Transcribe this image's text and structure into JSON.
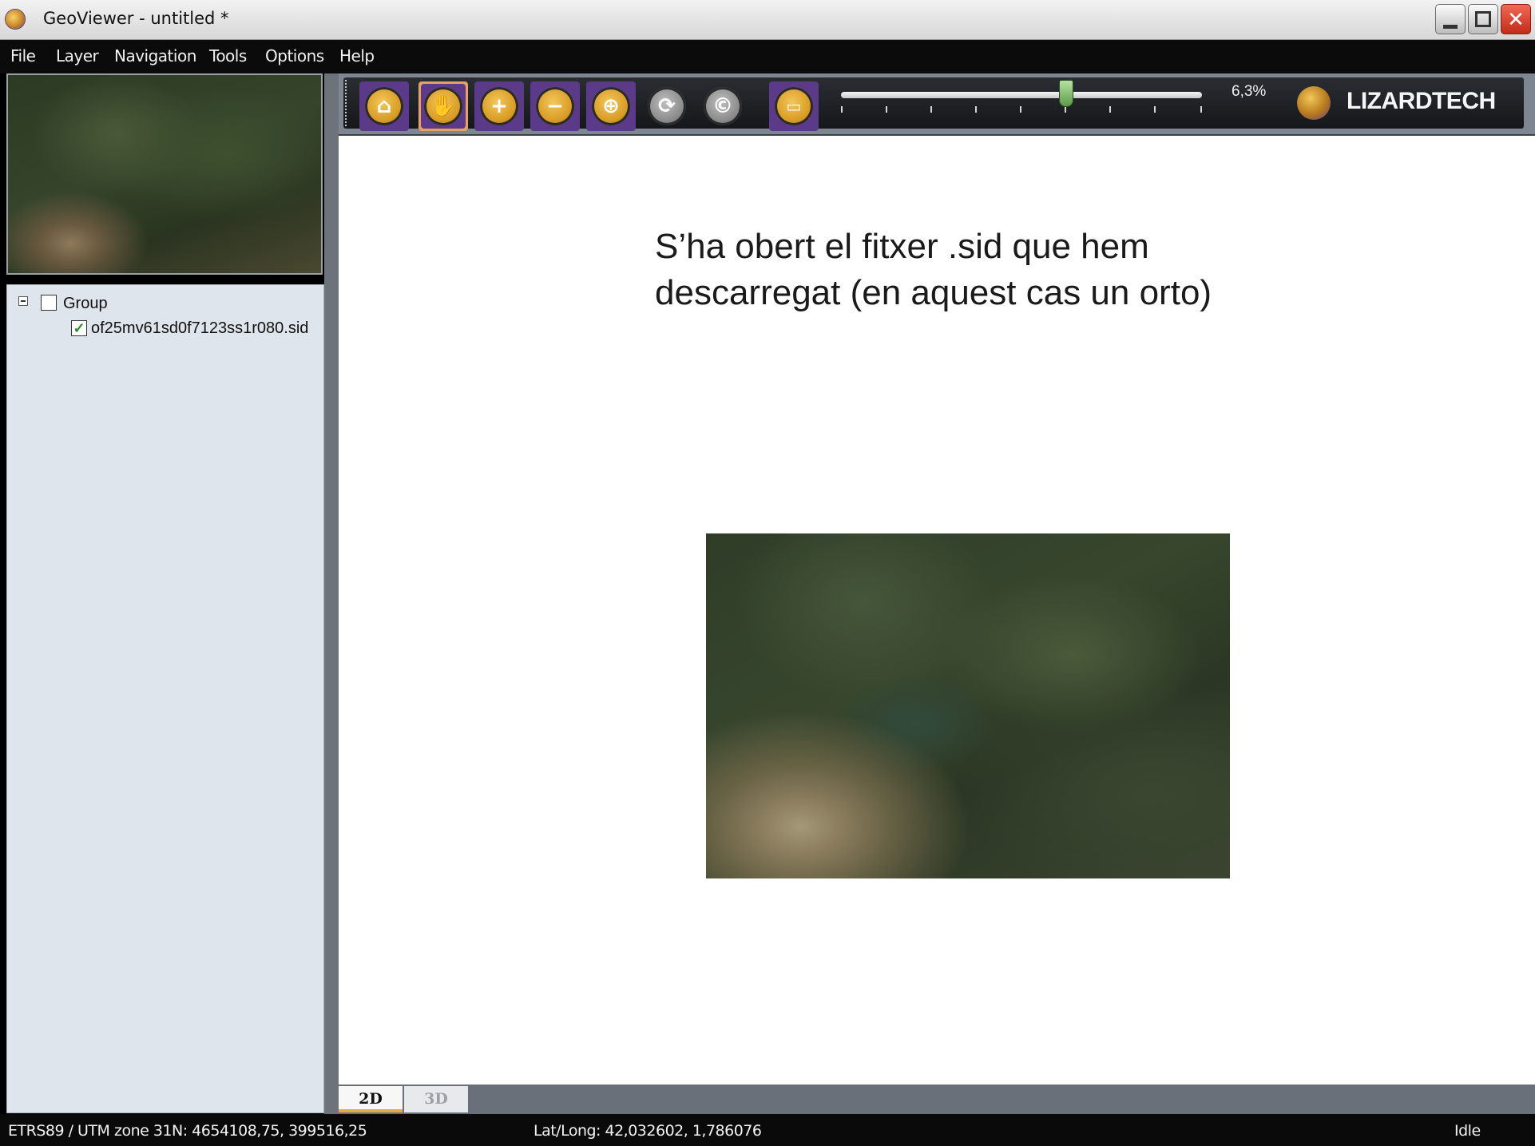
{
  "window": {
    "title": "GeoViewer - untitled *",
    "controls": {
      "minimize": "_",
      "maximize": "□",
      "close": "✕"
    }
  },
  "menu": {
    "items": [
      "File",
      "Layer",
      "Navigation",
      "Tools",
      "Options",
      "Help"
    ]
  },
  "toolbar": {
    "tools": [
      {
        "name": "home",
        "icon": "home-icon"
      },
      {
        "name": "pan",
        "icon": "hand-icon",
        "active": true
      },
      {
        "name": "zoom-in",
        "icon": "plus-icon"
      },
      {
        "name": "zoom-out",
        "icon": "minus-icon"
      },
      {
        "name": "center",
        "icon": "crosshair-icon"
      },
      {
        "name": "sync",
        "icon": "sync-icon"
      },
      {
        "name": "refresh",
        "icon": "refresh-icon"
      },
      {
        "name": "measure",
        "icon": "ruler-icon"
      }
    ],
    "zoom_percent": "6,3%",
    "zoom_fraction": 0.6,
    "brand": "LIZARDTECH"
  },
  "layers": {
    "group_label": "Group",
    "group_checked": false,
    "file_label": "of25mv61sd0f7123ss1r080.sid",
    "file_checked": true
  },
  "canvas": {
    "annotation_line1": "S’ha obert el fitxer .sid que hem",
    "annotation_line2": "descarregat (en aquest cas un orto)"
  },
  "tabs": {
    "tab_2d": "2D",
    "tab_3d": "3D",
    "active": "2D"
  },
  "status": {
    "projection": "ETRS89 / UTM zone 31N: 4654108,75, 399516,25",
    "latlong": "Lat/Long: 42,032602, 1,786076",
    "state": "Idle"
  },
  "colors": {
    "accent_purple": "#5b3a8a",
    "tool_gold": "#d89a24",
    "active_outline": "#e9a063",
    "panel_bg": "#dfe5ec"
  }
}
